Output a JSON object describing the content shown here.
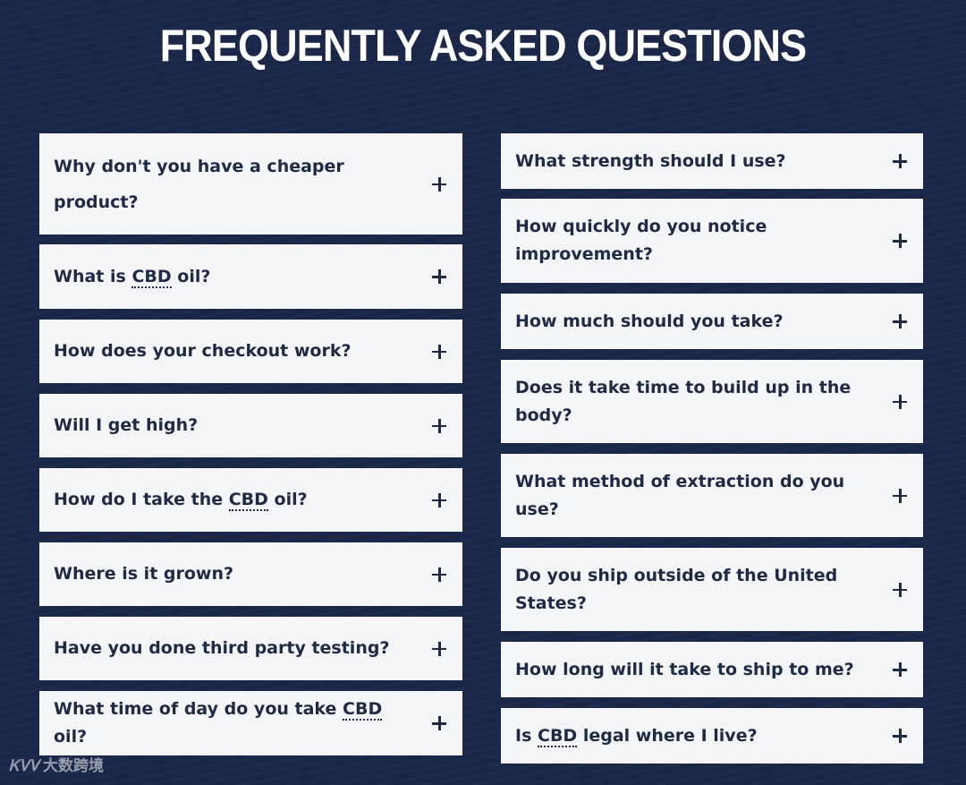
{
  "page": {
    "title": "FREQUENTLY ASKED QUESTIONS"
  },
  "left_column": [
    {
      "question": "Why don't you have a cheaper product?"
    },
    {
      "question_before": "What is ",
      "abbr": "CBD",
      "question_after": " oil?"
    },
    {
      "question": "How does your checkout work?"
    },
    {
      "question": "Will I get high?"
    },
    {
      "question_before": "How do I take the ",
      "abbr": "CBD",
      "question_after": " oil?"
    },
    {
      "question": "Where is it grown?"
    },
    {
      "question": "Have you done third party testing?"
    },
    {
      "question_before": "What time of day do you take ",
      "abbr": "CBD",
      "question_after": " oil?"
    }
  ],
  "right_column": [
    {
      "question": "What strength should I use?"
    },
    {
      "question": "How quickly do you notice improvement?"
    },
    {
      "question": "How much should you take?"
    },
    {
      "question": "Does it take time to build up in the body?"
    },
    {
      "question": "What method of extraction do you use?"
    },
    {
      "question": "Do you ship outside of the United States?"
    },
    {
      "question": "How long will it take to ship to me?"
    },
    {
      "question_before": "Is ",
      "abbr": "CBD",
      "question_after": " legal where I live?"
    }
  ],
  "expand_icon": "plus-icon",
  "watermark": {
    "logo": "ᏦᏙᏙ",
    "text": "大数跨境"
  },
  "colors": {
    "background": "#1b2749",
    "card": "#f4f5f6",
    "text": "#1e2a46",
    "title": "#ffffff"
  }
}
